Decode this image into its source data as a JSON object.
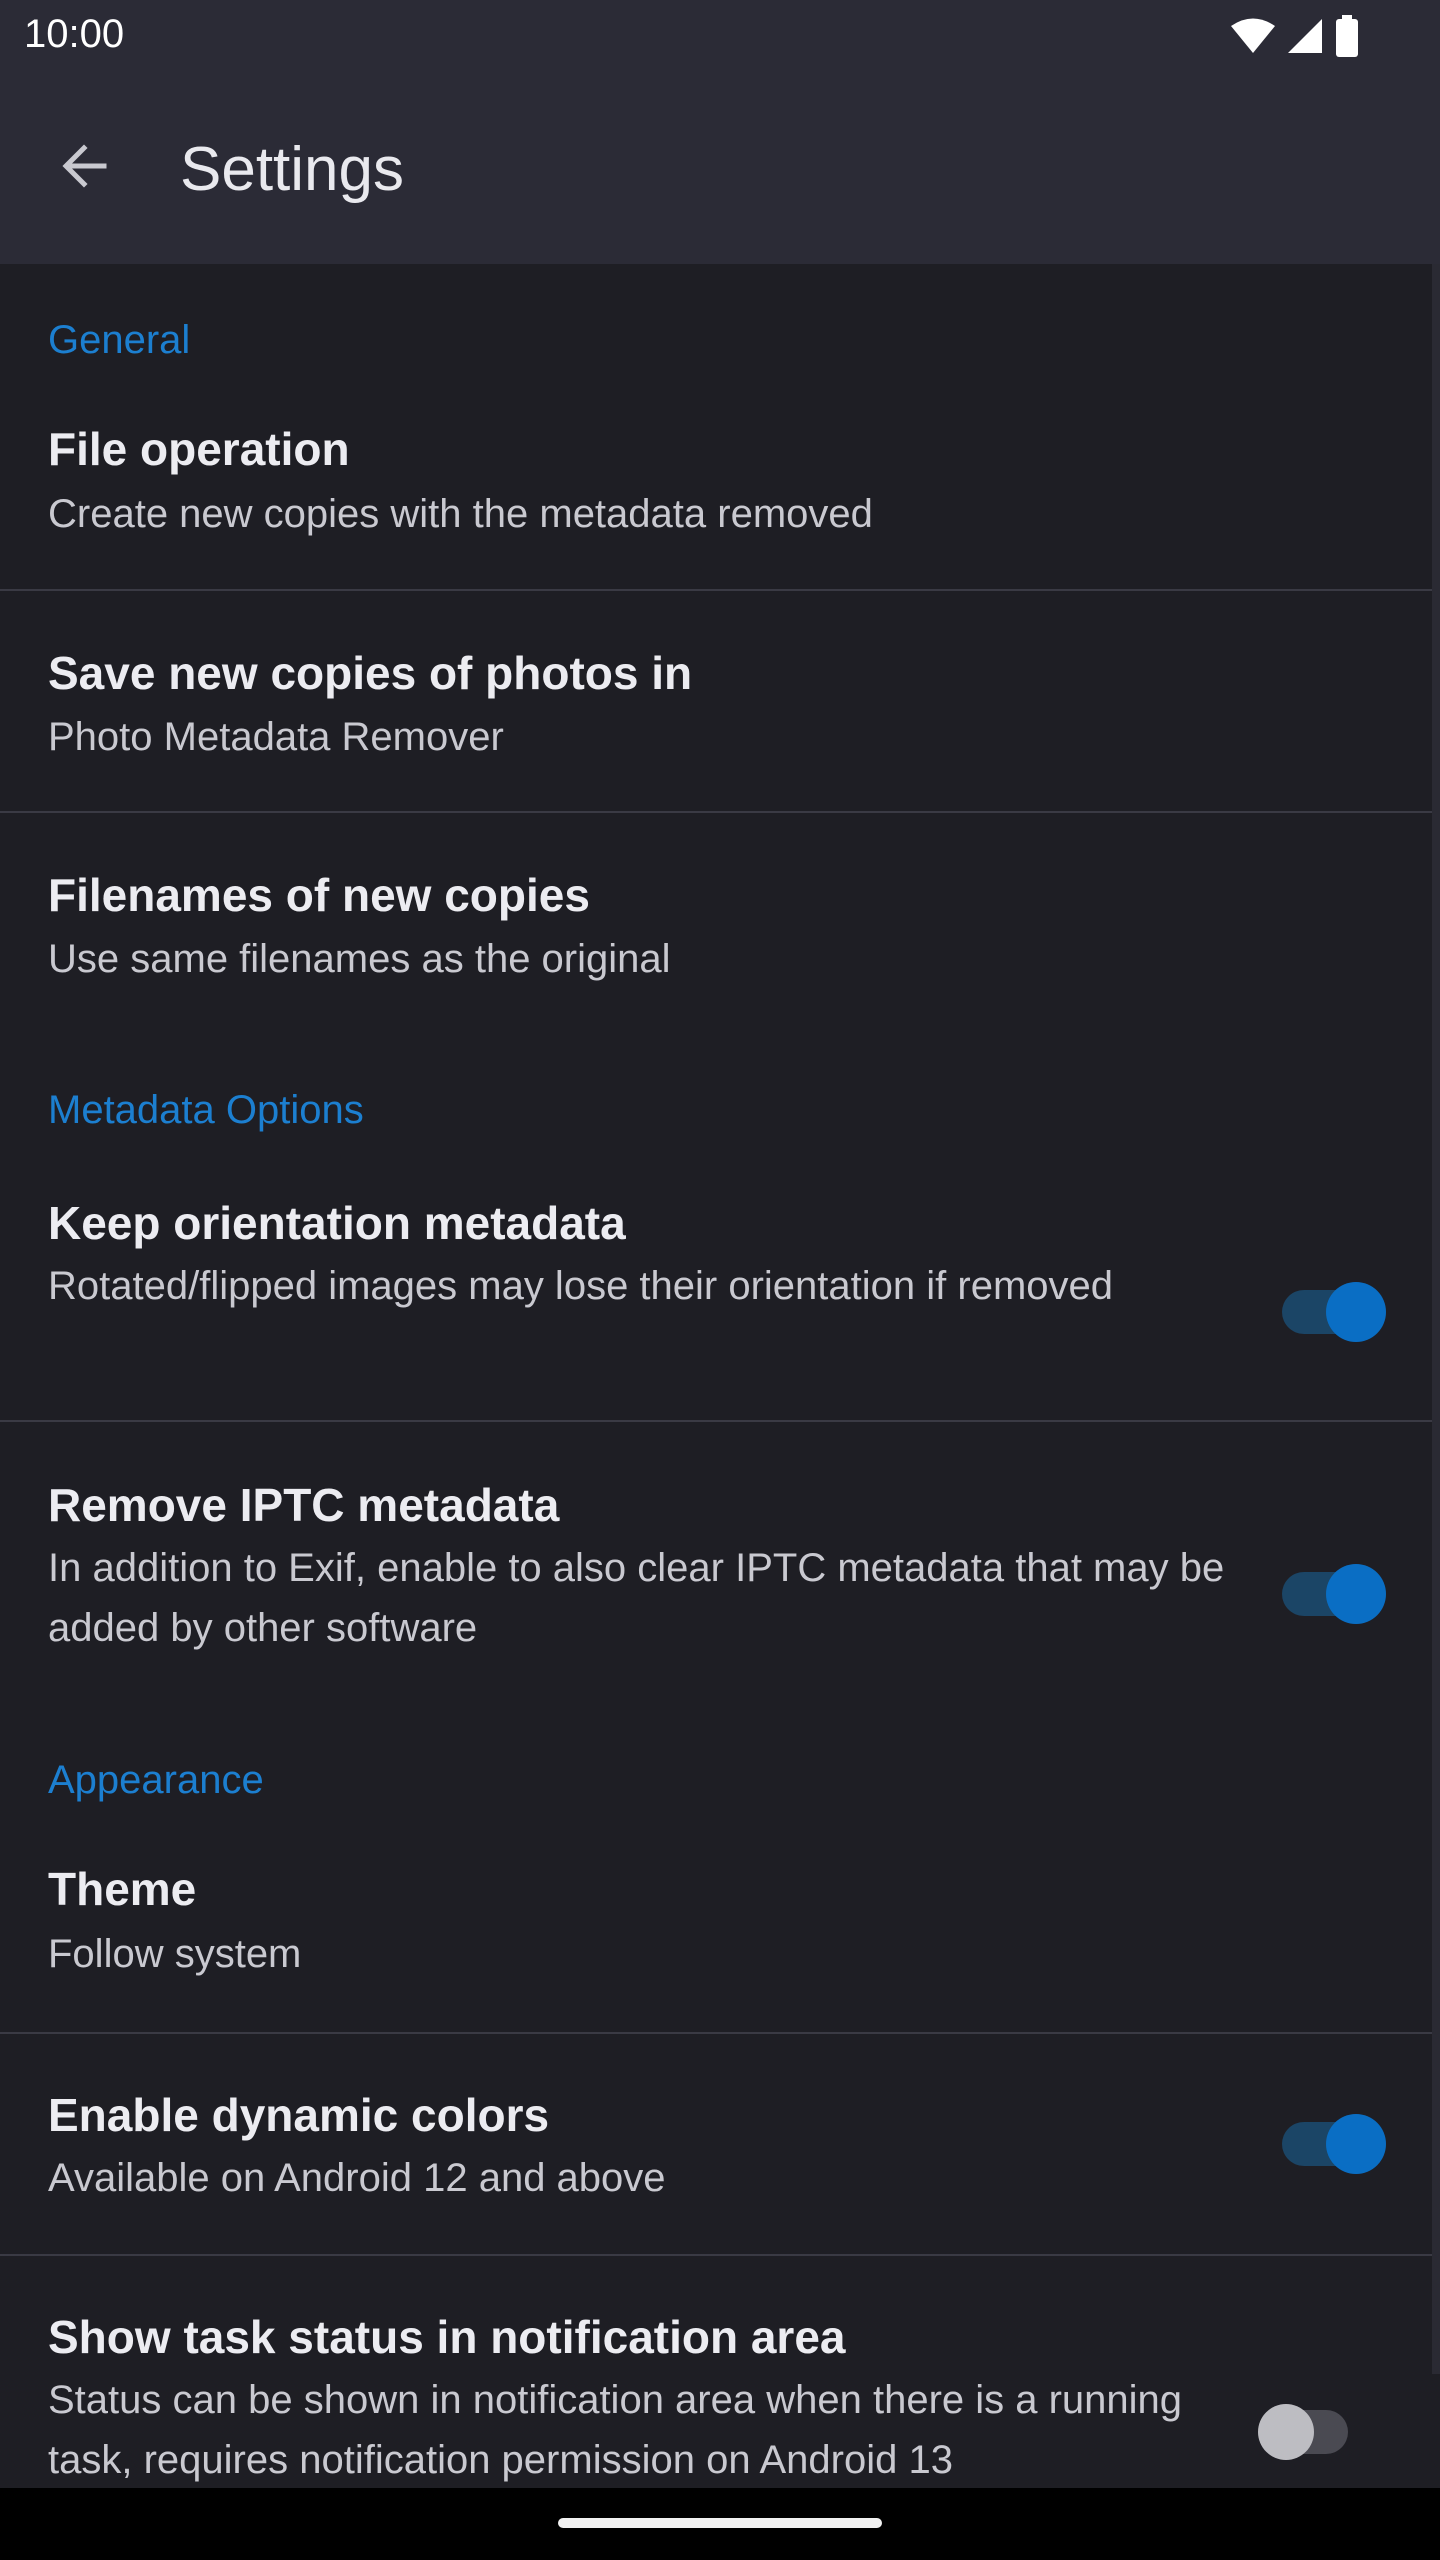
{
  "status_bar": {
    "time": "10:00",
    "icons": [
      "wifi-icon",
      "cellular-signal-icon",
      "battery-icon"
    ]
  },
  "app_bar": {
    "back_icon": "arrow-back-icon",
    "title": "Settings"
  },
  "colors": {
    "accent": "#1c7fd0",
    "switch_on": "#0a6ec4",
    "background": "#1e1e24",
    "app_bar": "#2b2b36"
  },
  "sections": {
    "general": {
      "header": "General",
      "file_operation": {
        "title": "File operation",
        "summary": "Create new copies with the metadata removed"
      },
      "save_location": {
        "title": "Save new copies of photos in",
        "summary": "Photo Metadata Remover"
      },
      "filenames": {
        "title": "Filenames of new copies",
        "summary": "Use same filenames as the original"
      }
    },
    "metadata": {
      "header": "Metadata Options",
      "keep_orientation": {
        "title": "Keep orientation metadata",
        "summary": "Rotated/flipped images may lose their orientation if removed",
        "enabled": true
      },
      "remove_iptc": {
        "title": "Remove IPTC metadata",
        "summary": "In addition to Exif, enable to also clear IPTC metadata that may be added by other software",
        "enabled": true
      }
    },
    "appearance": {
      "header": "Appearance",
      "theme": {
        "title": "Theme",
        "summary": "Follow system"
      },
      "dynamic_colors": {
        "title": "Enable dynamic colors",
        "summary": "Available on Android 12 and above",
        "enabled": true
      },
      "task_status": {
        "title": "Show task status in notification area",
        "summary": "Status can be shown in notification area when there is a running task, requires notification permission on Android 13",
        "enabled": false
      }
    }
  }
}
